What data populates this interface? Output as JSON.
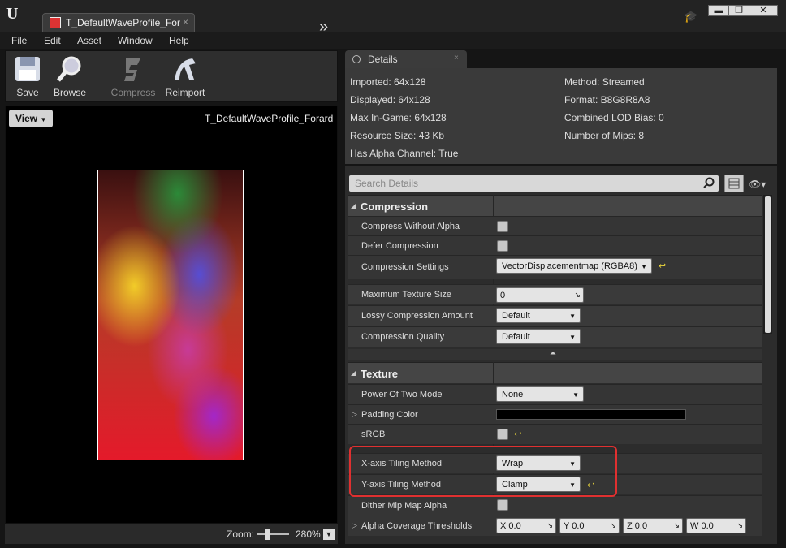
{
  "window": {
    "tab_title": "T_DefaultWaveProfile_For",
    "tab_close": "×",
    "min": "▬",
    "max": "❐",
    "close": "✕"
  },
  "menu": [
    "File",
    "Edit",
    "Asset",
    "Window",
    "Help"
  ],
  "toolbar": {
    "save": "Save",
    "browse": "Browse",
    "compress": "Compress",
    "reimport": "Reimport"
  },
  "viewport": {
    "view_button": "View",
    "title": "T_DefaultWaveProfile_Forard",
    "zoom_label": "Zoom:",
    "zoom_value": "280%"
  },
  "details": {
    "tab_label": "Details",
    "info_left": [
      "Imported: 64x128",
      "Displayed: 64x128",
      "Max In-Game: 64x128",
      "Resource Size: 43 Kb",
      "Has Alpha Channel: True"
    ],
    "info_right": [
      "Method: Streamed",
      "Format: B8G8R8A8",
      "Combined LOD Bias: 0",
      "Number of Mips: 8"
    ],
    "search_placeholder": "Search Details",
    "compression": {
      "title": "Compression",
      "compress_without_alpha": "Compress Without Alpha",
      "defer_compression": "Defer Compression",
      "compression_settings": "Compression Settings",
      "compression_settings_value": "VectorDisplacementmap (RGBA8)",
      "max_texture_size": "Maximum Texture Size",
      "max_texture_size_value": "0",
      "lossy": "Lossy Compression Amount",
      "lossy_value": "Default",
      "quality": "Compression Quality",
      "quality_value": "Default"
    },
    "texture": {
      "title": "Texture",
      "power_of_two": "Power Of Two Mode",
      "power_of_two_value": "None",
      "padding_color": "Padding Color",
      "srgb": "sRGB",
      "x_tiling": "X-axis Tiling Method",
      "x_tiling_value": "Wrap",
      "y_tiling": "Y-axis Tiling Method",
      "y_tiling_value": "Clamp",
      "dither": "Dither Mip Map Alpha",
      "alpha_cov": "Alpha Coverage Thresholds",
      "alpha_cov_values": [
        {
          "label": "X",
          "value": "0.0"
        },
        {
          "label": "Y",
          "value": "0.0"
        },
        {
          "label": "Z",
          "value": "0.0"
        },
        {
          "label": "W",
          "value": "0.0"
        }
      ]
    }
  }
}
